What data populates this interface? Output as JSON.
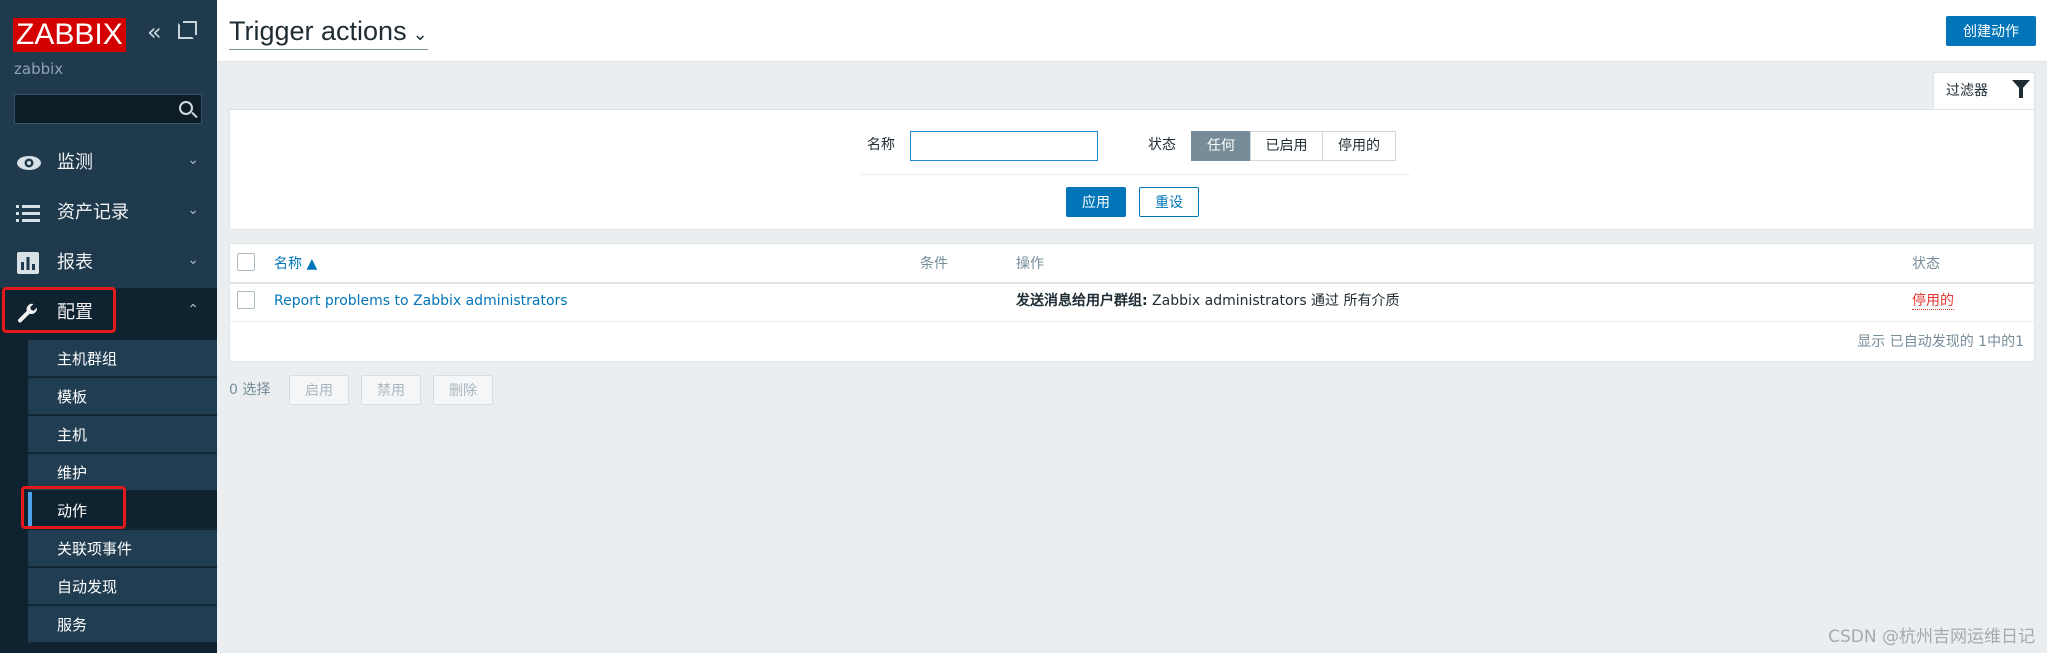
{
  "sidebar": {
    "logo": "ZABBIX",
    "server_name": "zabbix",
    "search_value": "",
    "menu": [
      {
        "label": "监测",
        "icon": "eye-icon"
      },
      {
        "label": "资产记录",
        "icon": "list-icon"
      },
      {
        "label": "报表",
        "icon": "bar-chart-icon"
      },
      {
        "label": "配置",
        "icon": "wrench-icon"
      }
    ],
    "submenu": [
      "主机群组",
      "模板",
      "主机",
      "维护",
      "动作",
      "关联项事件",
      "自动发现",
      "服务"
    ]
  },
  "header": {
    "title": "Trigger actions",
    "create_label": "创建动作"
  },
  "filter": {
    "tab_label": "过滤器",
    "name_label": "名称",
    "name_value": "",
    "status_label": "状态",
    "status_options": [
      "任何",
      "已启用",
      "停用的"
    ],
    "status_selected": "任何",
    "apply_label": "应用",
    "reset_label": "重设"
  },
  "table": {
    "columns": [
      "名称 ▲",
      "条件",
      "操作",
      "状态"
    ],
    "rows": [
      {
        "name": "Report problems to Zabbix administrators",
        "conditions": "",
        "operation_bold": "发送消息给用户群组:",
        "operation_text": " Zabbix administrators 通过 所有介质",
        "status": "停用的"
      }
    ],
    "paging": "显示 已自动发现的 1中的1"
  },
  "bulk": {
    "count": "0 选择",
    "enable": "启用",
    "disable": "禁用",
    "delete": "删除"
  },
  "watermark": "CSDN @杭州吉网运维日记",
  "colors": {
    "sidebar": "#1f3a4d",
    "accent": "#0275b8",
    "highlight": "#e31a1a",
    "disabled_status": "#e33734"
  }
}
